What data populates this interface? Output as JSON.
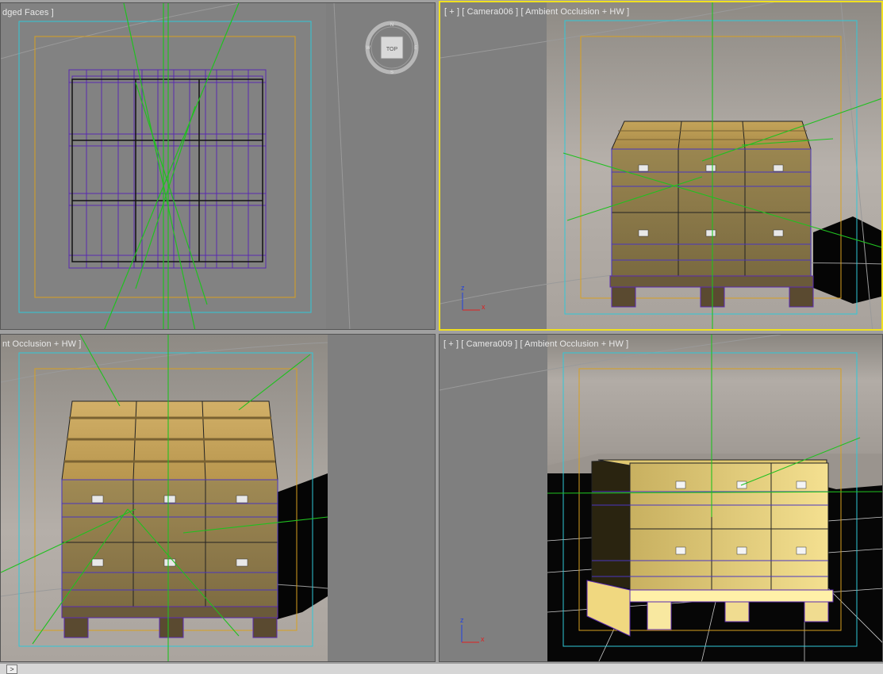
{
  "viewports": {
    "top_left": {
      "label": "dged Faces ]",
      "view_cube": "TOP"
    },
    "top_right": {
      "label": "[ + ] [ Camera006 ] [ Ambient Occlusion + HW ]"
    },
    "bottom_left": {
      "label": "nt Occlusion + HW ]"
    },
    "bottom_right": {
      "label": "[ + ] [ Camera009 ] [ Ambient Occlusion + HW ]"
    }
  },
  "axis_tripod": {
    "z": "z",
    "x": "x"
  },
  "status_bar": {
    "prompt": ">"
  },
  "colors": {
    "viewport_bg": "#7f7f7f",
    "active_border": "#f0e020",
    "safe_frame_outer": "#30c8d8",
    "safe_frame_inner": "#d8a020",
    "wireframe": "#5a2ab0",
    "helper_lines": "#20c020"
  }
}
